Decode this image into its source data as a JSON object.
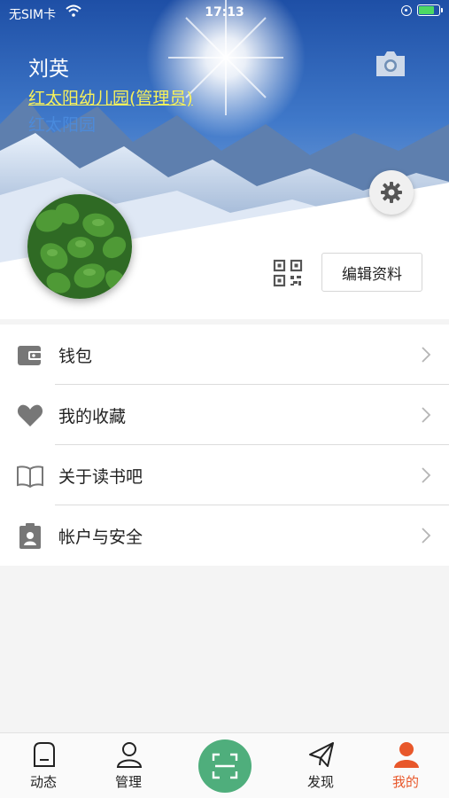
{
  "status_bar": {
    "carrier": "无SIM卡",
    "time": "17:13"
  },
  "profile": {
    "name": "刘英",
    "role": "红太阳幼儿园(管理员)",
    "school": "红太阳园",
    "edit_label": "编辑资料"
  },
  "menu": [
    {
      "label": "钱包",
      "icon": "wallet-icon"
    },
    {
      "label": "我的收藏",
      "icon": "heart-icon"
    },
    {
      "label": "关于读书吧",
      "icon": "book-icon"
    },
    {
      "label": "帐户与安全",
      "icon": "badge-icon"
    }
  ],
  "tabs": [
    {
      "label": "动态",
      "icon": "home-icon"
    },
    {
      "label": "管理",
      "icon": "person-icon"
    },
    {
      "label": "",
      "icon": "scan-icon"
    },
    {
      "label": "发现",
      "icon": "paper-plane-icon"
    },
    {
      "label": "我的",
      "icon": "user-filled-icon",
      "active": true
    }
  ],
  "colors": {
    "accent": "#e8572a",
    "scan": "#4fae7c",
    "role_text": "#f7f15a"
  }
}
